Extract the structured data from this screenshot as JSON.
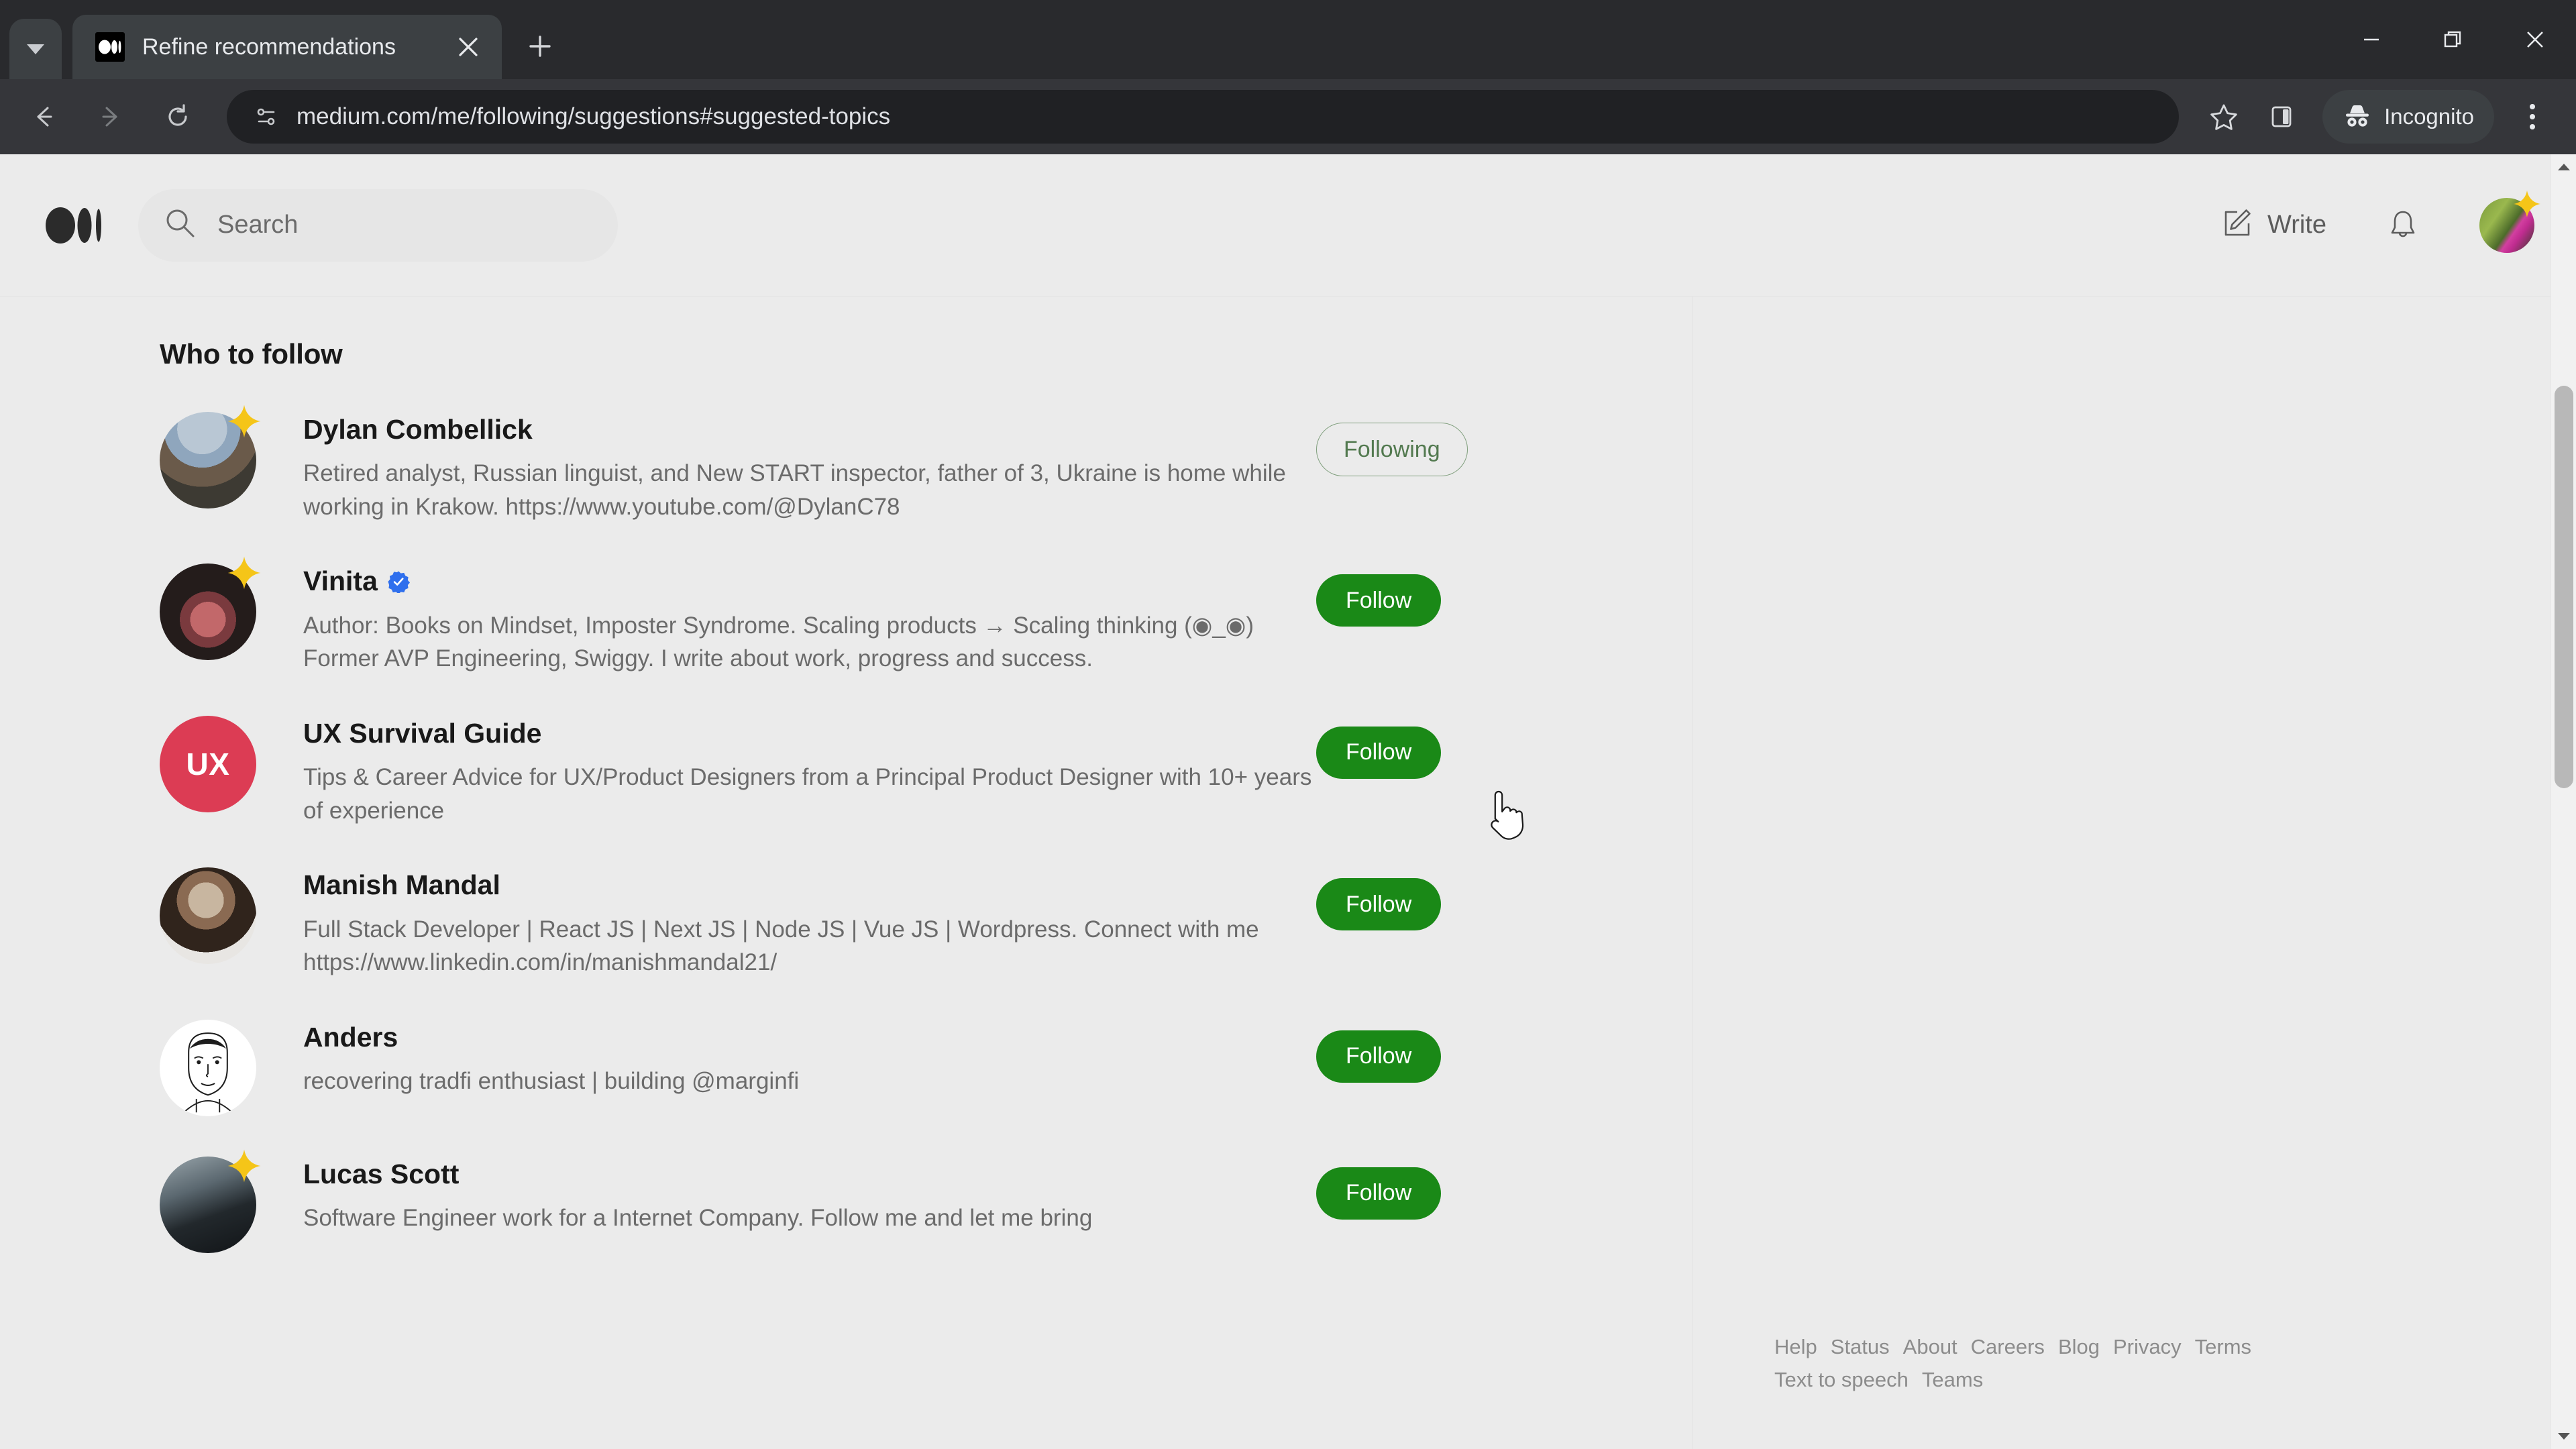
{
  "browser": {
    "tab": {
      "title": "Refine recommendations",
      "favicon_name": "medium-favicon"
    },
    "new_tab_label": "+",
    "omnibox": {
      "url": "medium.com/me/following/suggestions#suggested-topics",
      "site_info_icon": "page-info-icon"
    },
    "profile_chip_label": "Incognito",
    "window_controls": {
      "minimize": "minimize",
      "maximize": "restore",
      "close": "close"
    }
  },
  "site": {
    "header": {
      "logo_name": "medium-logo",
      "search_placeholder": "Search",
      "search_value": "",
      "write_label": "Write",
      "notifications_name": "bell-icon",
      "avatar_name": "user-avatar"
    },
    "main": {
      "section_title": "Who to follow",
      "people": [
        {
          "name": "Dylan Combellick",
          "bio": "Retired analyst, Russian linguist, and New START inspector, father of 3, Ukraine is home while working in Krakow. https://www.youtube.com/@DylanC78",
          "button": "Following",
          "following": true,
          "starred": true,
          "verified": false,
          "avatar_type": "photo",
          "avatar_colors": [
            "#8fa6bd",
            "#b9c7d4",
            "#6a5a4a",
            "#3d3a33"
          ]
        },
        {
          "name": "Vinita",
          "bio": "Author: Books on Mindset, Imposter Syndrome. Scaling products → Scaling thinking (◉_◉) Former AVP Engineering, Swiggy. I write about work, progress and success.",
          "button": "Follow",
          "following": false,
          "starred": true,
          "verified": true,
          "avatar_type": "photo",
          "avatar_colors": [
            "#241c1b",
            "#c2686a",
            "#7a3a3e",
            "#1a1312"
          ]
        },
        {
          "name": "UX Survival Guide",
          "bio": "Tips & Career Advice for UX/Product Designers from a Principal Product Designer with 10+ years of experience",
          "button": "Follow",
          "following": false,
          "starred": false,
          "verified": false,
          "avatar_type": "initials",
          "avatar_text": "UX",
          "avatar_bg": "#dc3c54"
        },
        {
          "name": "Manish Mandal",
          "bio": "Full Stack Developer | React JS | Next JS | Node JS | Vue JS | Wordpress. Connect with me https://www.linkedin.com/in/manishmandal21/",
          "button": "Follow",
          "following": false,
          "starred": false,
          "verified": false,
          "avatar_type": "photo",
          "avatar_colors": [
            "#c8b6a0",
            "#8a6a52",
            "#30241c",
            "#e8e6e3"
          ]
        },
        {
          "name": "Anders",
          "bio": "recovering tradfi enthusiast | building @marginfi",
          "button": "Follow",
          "following": false,
          "starred": false,
          "verified": false,
          "avatar_type": "sketch",
          "avatar_bg": "#ffffff"
        },
        {
          "name": "Lucas Scott",
          "bio": "Software Engineer work for a Internet Company. Follow me and let me bring",
          "button": "Follow",
          "following": false,
          "starred": true,
          "verified": false,
          "avatar_type": "photo",
          "avatar_colors": [
            "#9aa6ac",
            "#5b6870",
            "#22282c",
            "#111417"
          ]
        }
      ]
    },
    "sidebar": {
      "footer_links": [
        "Help",
        "Status",
        "About",
        "Careers",
        "Blog",
        "Privacy",
        "Terms",
        "Text to speech",
        "Teams"
      ]
    }
  },
  "colors": {
    "follow_green": "#1a8917",
    "following_green": "#52794f",
    "page_bg": "#ebebeb",
    "chrome_bg": "#292a2d",
    "toolbar_bg": "#35363a",
    "star_gold": "#f5c518",
    "verified_blue": "#2f6fed"
  }
}
